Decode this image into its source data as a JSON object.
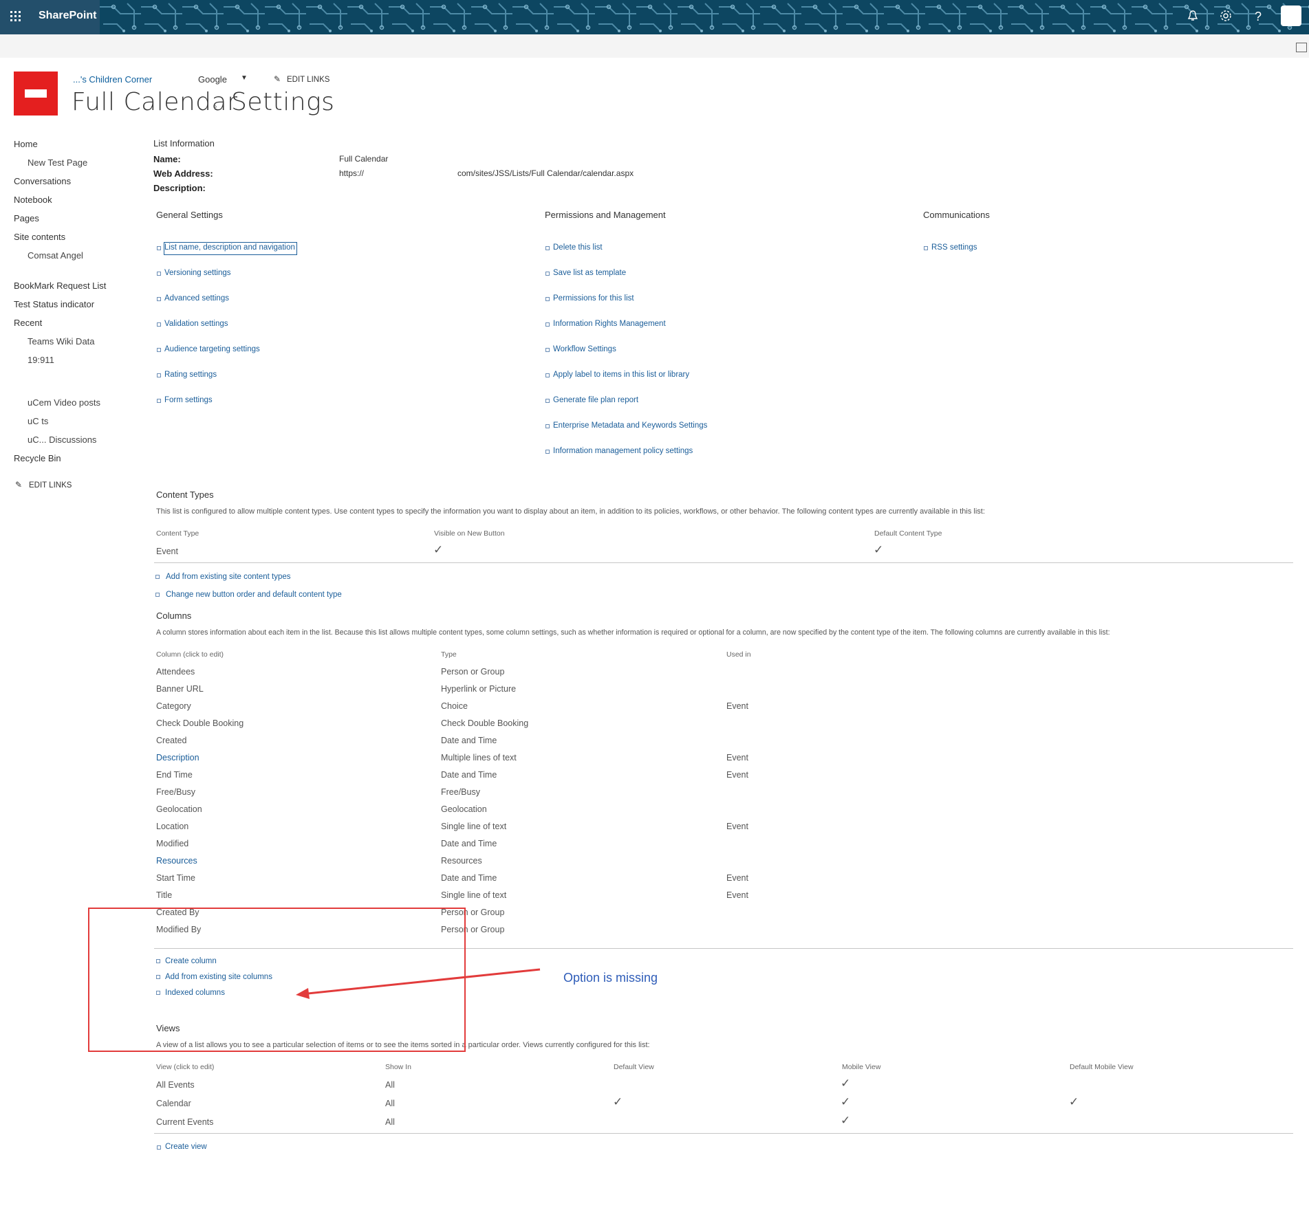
{
  "suite": {
    "brand": "SharePoint",
    "waffle_icon": "waffle-icon",
    "bell_icon": "bell-icon",
    "gear_icon": "gear-icon",
    "help_glyph": "?"
  },
  "header": {
    "site_link": "...'s Children Corner",
    "google_link": "Google",
    "edit_links": "EDIT LINKS",
    "title_list": "Full Calendar",
    "title_page": "Settings"
  },
  "left_nav": {
    "items": [
      "Home",
      "New Test Page",
      "Conversations",
      "Notebook",
      "Pages",
      "Site contents",
      "Comsat Angel",
      "BookMark Request List",
      "Test Status indicator",
      "Recent",
      "Teams Wiki Data",
      "19:911",
      "uCem Video posts",
      "uC          ts",
      "uC... Discussions",
      "Recycle Bin"
    ],
    "edit_links": "EDIT LINKS"
  },
  "list_info": {
    "heading": "List Information",
    "name_label": "Name:",
    "name_value": "Full Calendar",
    "web_label": "Web Address:",
    "web_value_prefix": "https://",
    "web_value_suffix": "com/sites/JSS/Lists/Full Calendar/calendar.aspx",
    "desc_label": "Description:"
  },
  "general": {
    "heading": "General Settings",
    "links": [
      "List name, description and navigation",
      "Versioning settings",
      "Advanced settings",
      "Validation settings",
      "Audience targeting settings",
      "Rating settings",
      "Form settings"
    ]
  },
  "permissions": {
    "heading": "Permissions and Management",
    "links": [
      "Delete this list",
      "Save list as template",
      "Permissions for this list",
      "Information Rights Management",
      "Workflow Settings",
      "Apply label to items in this list or library",
      "Generate file plan report",
      "Enterprise Metadata and Keywords Settings",
      "Information management policy settings"
    ]
  },
  "communications": {
    "heading": "Communications",
    "links": [
      "RSS settings"
    ]
  },
  "content_types": {
    "heading": "Content Types",
    "description": "This list is configured to allow multiple content types. Use content types to specify the information you want to display about an item, in addition to its policies, workflows, or other behavior. The following content types are currently available in this list:",
    "col_headers": [
      "Content Type",
      "Visible on New Button",
      "Default Content Type"
    ],
    "rows": [
      {
        "name": "Event",
        "visible": true,
        "default": true
      }
    ],
    "links": [
      "Add from existing site content types",
      "Change new button order and default content type"
    ]
  },
  "columns": {
    "heading": "Columns",
    "description": "A column stores information about each item in the list. Because this list allows multiple content types, some column settings, such as whether information is required or optional for a column, are now specified by the content type of the item. The following columns are currently available in this list:",
    "col_headers": [
      "Column (click to edit)",
      "Type",
      "Used in"
    ],
    "rows": [
      {
        "name": "Attendees",
        "type": "Person or Group",
        "used": ""
      },
      {
        "name": "Banner URL",
        "type": "Hyperlink or Picture",
        "used": ""
      },
      {
        "name": "Category",
        "type": "Choice",
        "used": "Event"
      },
      {
        "name": "Check Double Booking",
        "type": "Check Double Booking",
        "used": ""
      },
      {
        "name": "Created",
        "type": "Date and Time",
        "used": ""
      },
      {
        "name": "Description",
        "type": "Multiple lines of text",
        "used": "Event"
      },
      {
        "name": "End Time",
        "type": "Date and Time",
        "used": "Event"
      },
      {
        "name": "Free/Busy",
        "type": "Free/Busy",
        "used": ""
      },
      {
        "name": "Geolocation",
        "type": "Geolocation",
        "used": ""
      },
      {
        "name": "Location",
        "type": "Single line of text",
        "used": "Event"
      },
      {
        "name": "Modified",
        "type": "Date and Time",
        "used": ""
      },
      {
        "name": "Resources",
        "type": "Resources",
        "used": ""
      },
      {
        "name": "Start Time",
        "type": "Date and Time",
        "used": "Event"
      },
      {
        "name": "Title",
        "type": "Single line of text",
        "used": "Event"
      },
      {
        "name": "Created By",
        "type": "Person or Group",
        "used": ""
      },
      {
        "name": "Modified By",
        "type": "Person or Group",
        "used": ""
      }
    ],
    "links": [
      "Create column",
      "Add from existing site columns",
      "Indexed columns"
    ]
  },
  "views": {
    "heading": "Views",
    "description": "A view of a list allows you to see a particular selection of items or to see the items sorted in a particular order. Views currently configured for this list:",
    "col_headers": [
      "View (click to edit)",
      "Show In",
      "Default View",
      "Mobile View",
      "Default Mobile View"
    ],
    "rows": [
      {
        "name": "All Events",
        "show": "All",
        "default": false,
        "mobile": true,
        "default_mobile": false
      },
      {
        "name": "Calendar",
        "show": "All",
        "default": true,
        "mobile": true,
        "default_mobile": true
      },
      {
        "name": "Current Events",
        "show": "All",
        "default": false,
        "mobile": true,
        "default_mobile": false
      }
    ],
    "links": [
      "Create view"
    ]
  },
  "annotation": {
    "text": "Option is missing",
    "color": "#e23b3b"
  },
  "check_glyph": "✓"
}
